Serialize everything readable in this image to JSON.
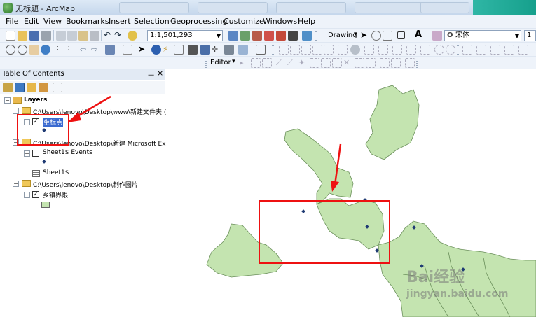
{
  "window": {
    "title": "无标题 - ArcMap"
  },
  "menu": [
    "File",
    "Edit",
    "View",
    "Bookmarks",
    "Insert",
    "Selection",
    "Geoprocessing",
    "Customize",
    "Windows",
    "Help"
  ],
  "toolbar": {
    "scale": "1:1,501,293",
    "drawing_label": "Drawing",
    "font_name": "宋体",
    "font_size": "1",
    "editor_label": "Editor"
  },
  "toc": {
    "title": "Table Of Contents",
    "pin_symbol": "ᅳ",
    "close_symbol": "×",
    "layers_label": "Layers",
    "items": [
      {
        "path": "C:\\Users\\lenovo\\Desktop\\www\\新建文件夹 (",
        "layer": "坐标点"
      },
      {
        "path": "C:\\Users\\lenovo\\Desktop\\新建 Microsoft Ex",
        "layer": "Sheet1$ Events",
        "table": "Sheet1$"
      },
      {
        "path": "C:\\Users\\lenovo\\Desktop\\制作图片",
        "layer": "乡镇界限"
      }
    ]
  },
  "watermark": {
    "brand": "Bai经验",
    "domain": "jingyan.baidu.com"
  },
  "colors": {
    "polygon_fill": "#c4e4b0",
    "polygon_stroke": "#6a8f5a",
    "annotation_red": "#ee1111",
    "point": "#1f3a73"
  }
}
